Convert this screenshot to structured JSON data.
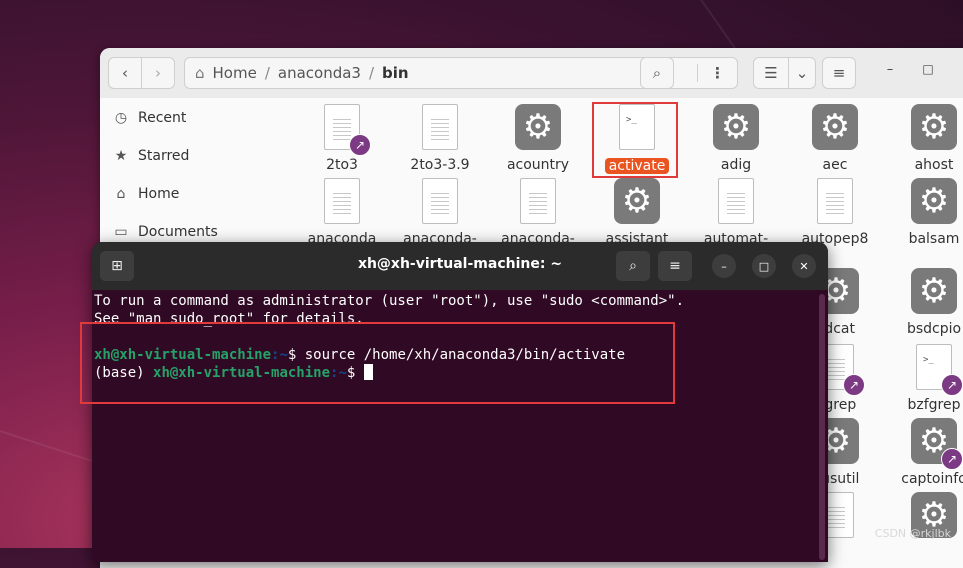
{
  "files": {
    "path": [
      "Home",
      "anaconda3",
      "bin"
    ],
    "sidebar": [
      {
        "icon": "clock-icon",
        "glyph": "◷",
        "label": "Recent"
      },
      {
        "icon": "star-icon",
        "glyph": "★",
        "label": "Starred"
      },
      {
        "icon": "home-icon",
        "glyph": "⌂",
        "label": "Home"
      },
      {
        "icon": "documents-icon",
        "glyph": "▭",
        "label": "Documents"
      }
    ],
    "items": [
      {
        "label": "2to3",
        "type": "doc-link"
      },
      {
        "label": "2to3-3.9",
        "type": "doc"
      },
      {
        "label": "acountry",
        "type": "exec"
      },
      {
        "label": "activate",
        "type": "script",
        "selected": true
      },
      {
        "label": "adig",
        "type": "exec"
      },
      {
        "label": "aec",
        "type": "exec"
      },
      {
        "label": "ahost",
        "type": "exec"
      },
      {
        "label": "anaconda",
        "type": "doc"
      },
      {
        "label": "anaconda-",
        "type": "doc"
      },
      {
        "label": "anaconda-",
        "type": "doc"
      },
      {
        "label": "assistant",
        "type": "exec"
      },
      {
        "label": "automat-",
        "type": "doc"
      },
      {
        "label": "autopep8",
        "type": "doc"
      },
      {
        "label": "balsam",
        "type": "exec"
      }
    ],
    "peek_items": [
      {
        "label": "sdcat",
        "type": "exec"
      },
      {
        "label": "bsdcpio",
        "type": "exec"
      },
      {
        "label": "egrep",
        "type": "doc-link"
      },
      {
        "label": "bzfgrep",
        "type": "script-link"
      },
      {
        "label": "ousutil",
        "type": "exec"
      },
      {
        "label": "captoinfo",
        "type": "exec-link"
      },
      {
        "label": "",
        "type": "doc"
      },
      {
        "label": "",
        "type": "exec"
      }
    ],
    "accent_color": "#e95420"
  },
  "terminal": {
    "title": "xh@xh-virtual-machine: ~",
    "lines": {
      "line1": "To run a command as administrator (user \"root\"), use \"sudo <command>\".",
      "line2": "See \"man sudo_root\" for details.",
      "prompt_user": "xh@xh-virtual-machine",
      "prompt_path": ":~",
      "prompt_sym": "$ ",
      "command": "source /home/xh/anaconda3/bin/activate",
      "env": "(base) "
    },
    "bg_color": "#300a24"
  },
  "watermark": "CSDN @rkjlbk"
}
